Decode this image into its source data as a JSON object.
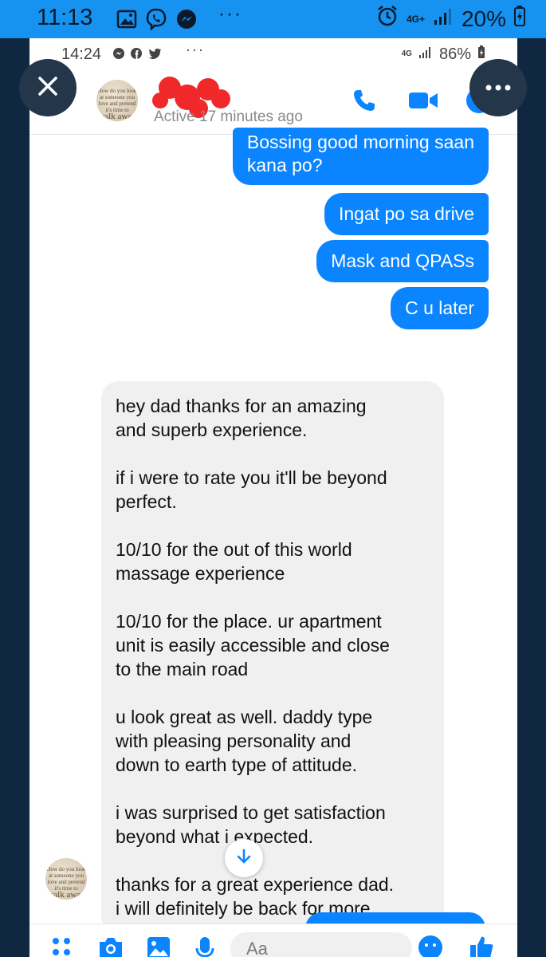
{
  "outer_status": {
    "time": "11:13",
    "dots": "···",
    "network": "4G+",
    "battery": "20%"
  },
  "inner_status": {
    "time": "14:24",
    "dots": "···",
    "network": "4G",
    "battery": "86%"
  },
  "header": {
    "avatar_text": "How do you look at someone you love and pretend it's time to",
    "avatar_big": "walk away",
    "active": "Active 17 minutes ago"
  },
  "messages": {
    "out": [
      "Bossing good morning saan\nkana po?",
      "Ingat po sa drive",
      "Mask and QPASs",
      "C u later"
    ],
    "in_text": "hey dad thanks for an amazing\nand superb experience.\n\nif i were to rate you it'll be beyond\nperfect.\n\n10/10 for the out of this world\nmassage experience\n\n10/10 for the place. ur apartment\nunit is easily accessible and close\nto the main road\n\nu look great as well. daddy type\nwith pleasing personality and\ndown to earth type of attitude.\n\ni was surprised to get satisfaction\nbeyond what i expected.\n\nthanks for a great experience dad.\ni will definitely be back for more."
  },
  "composer": {
    "placeholder": "Aa"
  },
  "colors": {
    "accent": "#0a84ff",
    "frame": "#0f2740",
    "status_bar": "#1692f0"
  }
}
